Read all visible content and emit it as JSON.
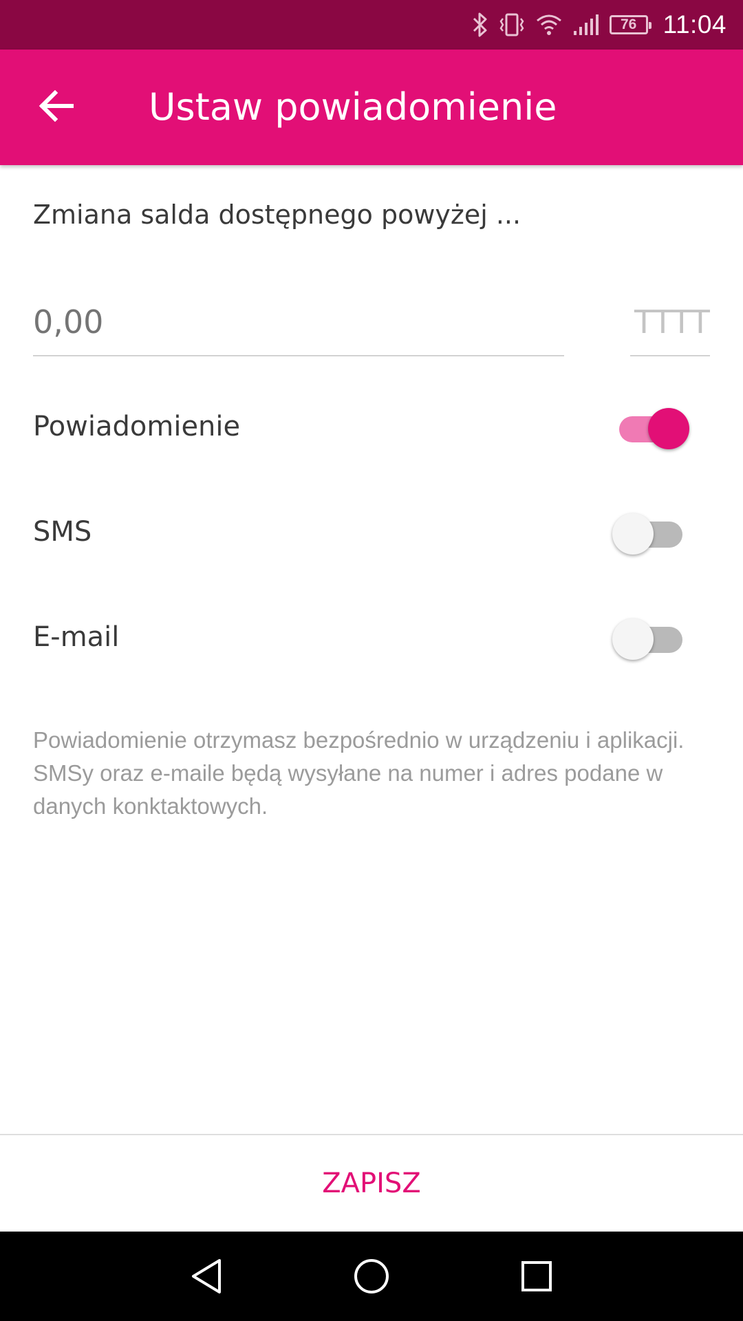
{
  "status_bar": {
    "time": "11:04",
    "battery": "76",
    "icons": [
      "bluetooth-icon",
      "vibrate-icon",
      "wifi-icon",
      "signal-icon",
      "battery-icon"
    ]
  },
  "app_bar": {
    "back_icon": "arrow-back-icon",
    "title": "Ustaw powiadomienie"
  },
  "form": {
    "heading": "Zmiana salda dostępnego powyżej ...",
    "amount": {
      "value": "",
      "placeholder": "0,00"
    },
    "currency": {
      "value": "",
      "placeholder": "TTTT"
    },
    "toggles": [
      {
        "label": "Powiadomienie",
        "checked": true
      },
      {
        "label": "SMS",
        "checked": false
      },
      {
        "label": "E-mail",
        "checked": false
      }
    ],
    "info": "Powiadomienie otrzymasz bezpośrednio w urządzeniu i aplikacji. SMSy oraz e-maile będą wysyłane na numer i adres podane w danych konktaktowych."
  },
  "actions": {
    "save_label": "ZAPISZ"
  },
  "nav_bar": {
    "icons": [
      "back-triangle-icon",
      "home-circle-icon",
      "recents-square-icon"
    ]
  },
  "colors": {
    "status_bar": "#8a0743",
    "accent": "#e20f76",
    "accent_light": "#f07ab4"
  }
}
